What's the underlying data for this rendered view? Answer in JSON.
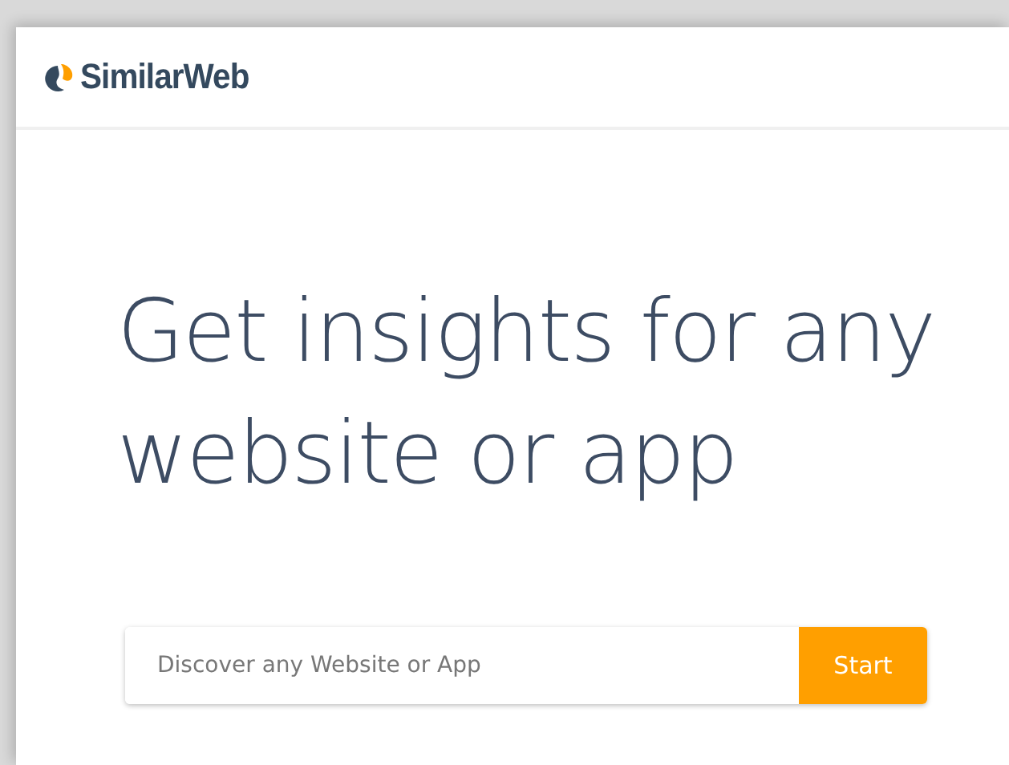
{
  "header": {
    "logo_text": "SimilarWeb"
  },
  "hero": {
    "headline": "Get insights for any website or app"
  },
  "search": {
    "placeholder": "Discover any Website or App",
    "button": "Start"
  }
}
